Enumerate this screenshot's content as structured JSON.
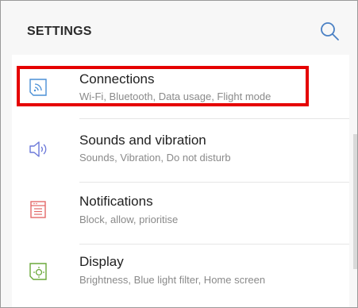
{
  "header": {
    "title": "SETTINGS"
  },
  "items": [
    {
      "title": "Connections",
      "subtitle": "Wi-Fi, Bluetooth, Data usage, Flight mode",
      "icon": "connections-icon",
      "color": "#4a8fd6"
    },
    {
      "title": "Sounds and vibration",
      "subtitle": "Sounds, Vibration, Do not disturb",
      "icon": "speaker-icon",
      "color": "#6b78d8"
    },
    {
      "title": "Notifications",
      "subtitle": "Block, allow, prioritise",
      "icon": "notifications-icon",
      "color": "#e36a6a"
    },
    {
      "title": "Display",
      "subtitle": "Brightness, Blue light filter, Home screen",
      "icon": "display-icon",
      "color": "#6aa83a"
    }
  ],
  "colors": {
    "highlight": "#e50000"
  }
}
